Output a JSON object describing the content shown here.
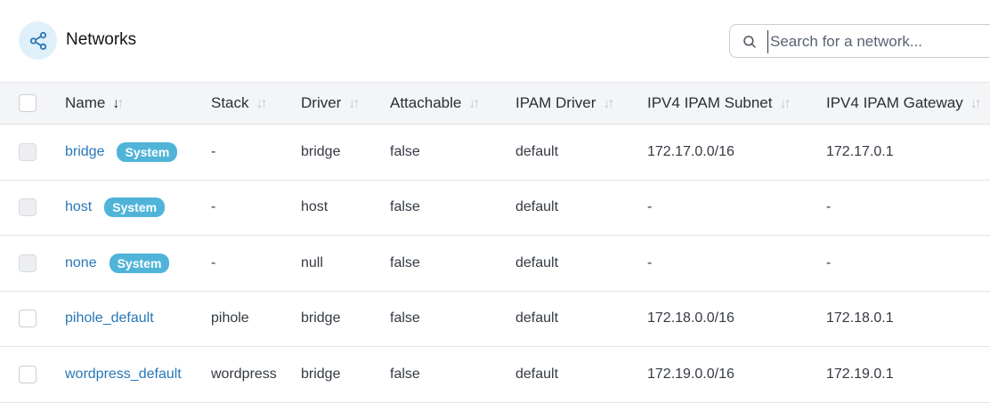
{
  "header": {
    "title": "Networks",
    "icon": "share-nodes-icon",
    "search": {
      "placeholder": "Search for a network...",
      "value": ""
    }
  },
  "colors": {
    "accent": "#2877b8",
    "badge": "#4fb4d8",
    "header_bg": "#f4f5f7"
  },
  "table": {
    "columns": [
      {
        "key": "name",
        "label": "Name",
        "sort": "desc"
      },
      {
        "key": "stack",
        "label": "Stack",
        "sort": "none"
      },
      {
        "key": "driver",
        "label": "Driver",
        "sort": "none"
      },
      {
        "key": "attachable",
        "label": "Attachable",
        "sort": "none"
      },
      {
        "key": "ipam_driver",
        "label": "IPAM Driver",
        "sort": "none"
      },
      {
        "key": "subnet",
        "label": "IPV4 IPAM Subnet",
        "sort": "none"
      },
      {
        "key": "gateway",
        "label": "IPV4 IPAM Gateway",
        "sort": "none"
      }
    ],
    "rows": [
      {
        "name": "bridge",
        "badge": "System",
        "stack": "-",
        "driver": "bridge",
        "attachable": "false",
        "ipam_driver": "default",
        "subnet": "172.17.0.0/16",
        "gateway": "172.17.0.1",
        "selectable": false
      },
      {
        "name": "host",
        "badge": "System",
        "stack": "-",
        "driver": "host",
        "attachable": "false",
        "ipam_driver": "default",
        "subnet": "-",
        "gateway": "-",
        "selectable": false
      },
      {
        "name": "none",
        "badge": "System",
        "stack": "-",
        "driver": "null",
        "attachable": "false",
        "ipam_driver": "default",
        "subnet": "-",
        "gateway": "-",
        "selectable": false
      },
      {
        "name": "pihole_default",
        "badge": "",
        "stack": "pihole",
        "driver": "bridge",
        "attachable": "false",
        "ipam_driver": "default",
        "subnet": "172.18.0.0/16",
        "gateway": "172.18.0.1",
        "selectable": true
      },
      {
        "name": "wordpress_default",
        "badge": "",
        "stack": "wordpress",
        "driver": "bridge",
        "attachable": "false",
        "ipam_driver": "default",
        "subnet": "172.19.0.0/16",
        "gateway": "172.19.0.1",
        "selectable": true
      }
    ]
  }
}
